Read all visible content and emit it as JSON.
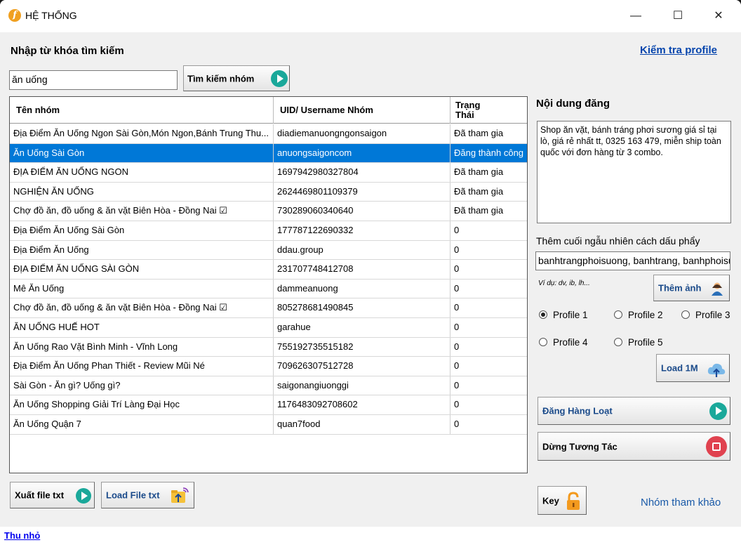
{
  "window": {
    "title": "HỆ THỐNG",
    "app_icon_letter": "f",
    "minimize": "—",
    "maximize": "☐",
    "close": "✕"
  },
  "search": {
    "label": "Nhập từ khóa tìm kiếm",
    "value": "ăn uống",
    "button": "Tìm kiếm nhóm",
    "check_profile_link": "Kiểm tra profile"
  },
  "table": {
    "columns": [
      "Tên nhóm",
      "UID/ Username Nhóm",
      "Trạng\nThái"
    ],
    "rows": [
      [
        "Địa Điểm Ăn Uống Ngon Sài Gòn,Món Ngon,Bánh Trung Thu...",
        "diadiemanuongngonsaigon",
        "Đã tham gia"
      ],
      [
        "Ăn Uống Sài Gòn",
        "anuongsaigoncom",
        "Đăng thành công"
      ],
      [
        "ĐỊA ĐIỂM ĂN UỐNG NGON",
        "1697942980327804",
        "Đã tham gia"
      ],
      [
        "NGHIỆN ĂN UỐNG",
        "262446980110937​9",
        "Đã tham gia"
      ],
      [
        "Chợ đồ ăn, đồ uống & ăn vặt Biên Hòa - Đồng Nai ☑",
        "730289060340640",
        "Đã tham gia"
      ],
      [
        "Địa Điểm Ăn Uống Sài Gòn",
        "177787122690332",
        "0"
      ],
      [
        "Địa Điểm Ăn Uống",
        "ddau.group",
        "0"
      ],
      [
        "ĐỊA ĐIỂM ĂN UỐNG SÀI GÒN",
        "231707748412708",
        "0"
      ],
      [
        "Mê Ăn Uống",
        "dammeanuong",
        "0"
      ],
      [
        "Chợ đồ ăn, đồ uống & ăn vặt Biên Hòa - Đồng Nai ☑",
        "805278681490845",
        "0"
      ],
      [
        "ĂN UỐNG HUẾ HOT",
        "garahue",
        "0"
      ],
      [
        "Ăn Uống Rao Vặt Bình Minh - Vĩnh Long",
        "755192735515182",
        "0"
      ],
      [
        "Địa Điểm Ăn Uống Phan Thiết - Review Mũi Né",
        "709626307512728",
        "0"
      ],
      [
        "Sài Gòn - Ăn gì? Uống gì?",
        "saigonangiuonggi",
        "0"
      ],
      [
        "Ăn Uống Shopping Giải Trí Làng Đại Học",
        "1176483092708602",
        "0"
      ],
      [
        "Ăn Uống Quận 7",
        "quan7food",
        "0"
      ]
    ],
    "selected_index": 1
  },
  "post": {
    "label": "Nội dung đăng",
    "content": "Shop ăn vặt, bánh tráng phơi sương giá sỉ tại lò, giá rẻ nhất tt, 0325 163 479, miễn ship toàn quốc với đơn hàng từ 3 combo.",
    "tail_label": "Thêm cuối ngẫu nhiên cách dấu phẩy",
    "tail_value": "banhtrangphoisuong, banhtrang, banhphoisuong",
    "example": "Ví dụ: dv, ib, lh...",
    "add_image_button": "Thêm ảnh"
  },
  "profiles": {
    "options": [
      "Profile 1",
      "Profile 2",
      "Profile 3",
      "Profile 4",
      "Profile 5"
    ],
    "selected": 0
  },
  "buttons": {
    "load_1m": "Load 1M",
    "bulk_post": "Đăng Hàng Loạt",
    "stop": "Dừng Tương Tác",
    "export": "Xuất file txt",
    "load_file": "Load File txt",
    "key": "Key"
  },
  "links": {
    "reference_groups": "Nhóm tham khảo",
    "minimize": "Thu nhỏ"
  },
  "colors": {
    "accent_blue": "#0078d7",
    "link_blue": "#0645ad",
    "play_teal": "#1aa89a",
    "stop_red": "#e0424f",
    "lock_orange": "#f39a1e"
  }
}
